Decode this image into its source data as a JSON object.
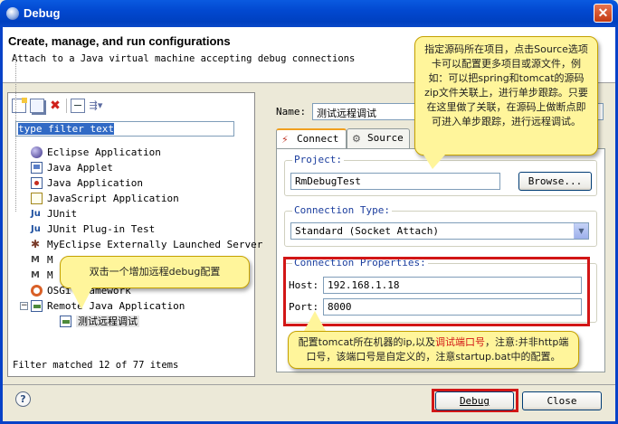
{
  "window": {
    "title": "Debug",
    "close_glyph": "✕"
  },
  "header": {
    "title": "Create, manage, and run configurations",
    "subtitle": "Attach to a Java virtual machine accepting debug connections"
  },
  "left": {
    "filter_text": "type filter text",
    "tree": [
      {
        "label": "Eclipse Application",
        "icon": "eclipse-icon"
      },
      {
        "label": "Java Applet",
        "icon": "applet-icon"
      },
      {
        "label": "Java Application",
        "icon": "java-app-icon"
      },
      {
        "label": "JavaScript Application",
        "icon": "javascript-icon"
      },
      {
        "label": "JUnit",
        "icon": "junit-icon",
        "glyph": "Ju"
      },
      {
        "label": "JUnit Plug-in Test",
        "icon": "junit-plugin-icon",
        "glyph": "Ju"
      },
      {
        "label": "MyEclipse Externally Launched Server",
        "icon": "myeclipse-server-icon",
        "glyph": "✱"
      },
      {
        "label": "M",
        "icon": "m-icon",
        "glyph": "M"
      },
      {
        "label": "M",
        "icon": "m-icon",
        "glyph": "M"
      },
      {
        "label": "OSGi Framework",
        "icon": "osgi-icon"
      },
      {
        "label": "Remote Java Application",
        "icon": "remote-java-icon"
      }
    ],
    "expander_glyph": "−",
    "child_item": "测试远程调试",
    "status": "Filter matched 12 of 77 items"
  },
  "right": {
    "name_label": "Name:",
    "name_value": "测试远程调试",
    "tabs": [
      {
        "label": "Connect",
        "icon": "connect-icon",
        "glyph": "⚡"
      },
      {
        "label": "Source",
        "icon": "source-icon",
        "glyph": "⚙"
      }
    ],
    "project_legend": "Project:",
    "project_value": "RmDebugTest",
    "browse_label": "Browse...",
    "conn_type_legend": "Connection Type:",
    "conn_type_value": "Standard (Socket Attach)",
    "dropdown_glyph": "▼",
    "conn_props_legend": "Connection Properties:",
    "host_label": "Host:",
    "host_value": "192.168.1.18",
    "port_label": "Port:",
    "port_value": "8000"
  },
  "footer": {
    "debug_label": "Debug",
    "close_label": "Close",
    "help_glyph": "?"
  },
  "callouts": {
    "top_right": "指定源码所在项目，点击Source选项卡可以配置更多项目或源文件，例如：可以把spring和tomcat的源码zip文件关联上，进行单步跟踪。只要在这里做了关联，在源码上做断点即可进入单步跟踪，进行远程调试。",
    "left_middle": "双击一个增加远程debug配置",
    "bottom_pre": "配置tomcat所在机器的ip,以及",
    "bottom_red": "调试端口号",
    "bottom_post": "，注意:并非http端口号，该端口号是自定义的，注意startup.bat中的配置。"
  },
  "colors": {
    "accent_red": "#d21616",
    "callout_bg": "#fff59b",
    "titlebar_blue": "#0248d0"
  }
}
